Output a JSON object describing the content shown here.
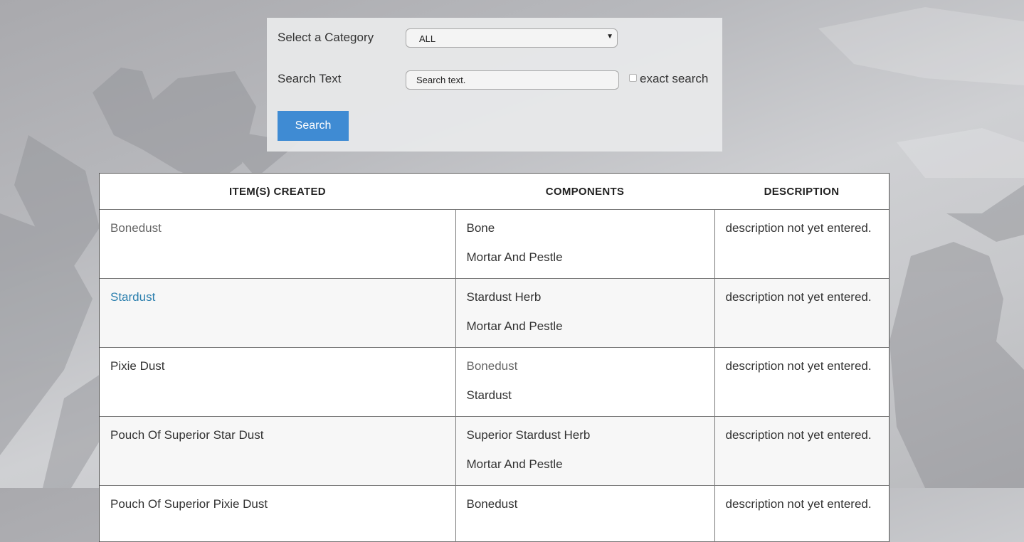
{
  "search_panel": {
    "category_label": "Select a Category",
    "category_value": "ALL",
    "search_label": "Search Text",
    "search_placeholder": "Search text.",
    "exact_label": "exact search",
    "search_button": "Search"
  },
  "table": {
    "headers": [
      "ITEM(S) CREATED",
      "COMPONENTS",
      "DESCRIPTION"
    ],
    "rows": [
      {
        "item": "Bonedust",
        "item_color": "#666666",
        "components": [
          "Bone",
          "Mortar And Pestle"
        ],
        "component_colors": [
          "#333333",
          "#333333"
        ],
        "description": "description not yet entered."
      },
      {
        "item": "Stardust",
        "item_color": "#2b7fae",
        "components": [
          "Stardust Herb",
          "Mortar And Pestle"
        ],
        "component_colors": [
          "#333333",
          "#333333"
        ],
        "description": "description not yet entered."
      },
      {
        "item": "Pixie Dust",
        "item_color": "#333333",
        "components": [
          "Bonedust",
          "Stardust"
        ],
        "component_colors": [
          "#666666",
          "#333333"
        ],
        "description": "description not yet entered."
      },
      {
        "item": "Pouch Of Superior Star Dust",
        "item_color": "#333333",
        "components": [
          "Superior Stardust Herb",
          "Mortar And Pestle"
        ],
        "component_colors": [
          "#333333",
          "#333333"
        ],
        "description": "description not yet entered."
      },
      {
        "item": "Pouch Of Superior Pixie Dust",
        "item_color": "#333333",
        "components": [
          "Bonedust",
          ""
        ],
        "component_colors": [
          "#333333",
          "#333333"
        ],
        "description": "description not yet entered."
      }
    ]
  },
  "colors": {
    "button": "#3f8bd3",
    "link": "#2b7fae"
  }
}
